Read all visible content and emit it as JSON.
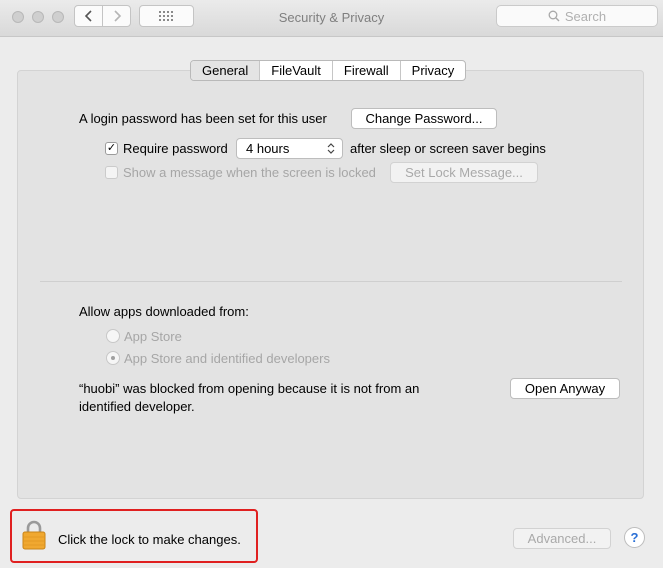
{
  "window": {
    "title": "Security & Privacy"
  },
  "search": {
    "placeholder": "Search"
  },
  "tabs": [
    {
      "label": "General"
    },
    {
      "label": "FileVault"
    },
    {
      "label": "Firewall"
    },
    {
      "label": "Privacy"
    }
  ],
  "general": {
    "login_password_text": "A login password has been set for this user",
    "change_password_label": "Change Password...",
    "require_password_label": "Require password",
    "require_password_value": "4 hours",
    "after_sleep_text": "after sleep or screen saver begins",
    "show_message_label": "Show a message when the screen is locked",
    "set_lock_message_label": "Set Lock Message..."
  },
  "downloads": {
    "heading": "Allow apps downloaded from:",
    "option_app_store": "App Store",
    "option_identified": "App Store and identified developers",
    "blocked_line1": "“huobi” was blocked from opening because it is not from an",
    "blocked_line2": "identified developer.",
    "open_anyway_label": "Open Anyway"
  },
  "footer": {
    "lock_text": "Click the lock to make changes.",
    "advanced_label": "Advanced...",
    "help_label": "?"
  },
  "colors": {
    "highlight": "#e02020",
    "lock": "#f0a830"
  }
}
